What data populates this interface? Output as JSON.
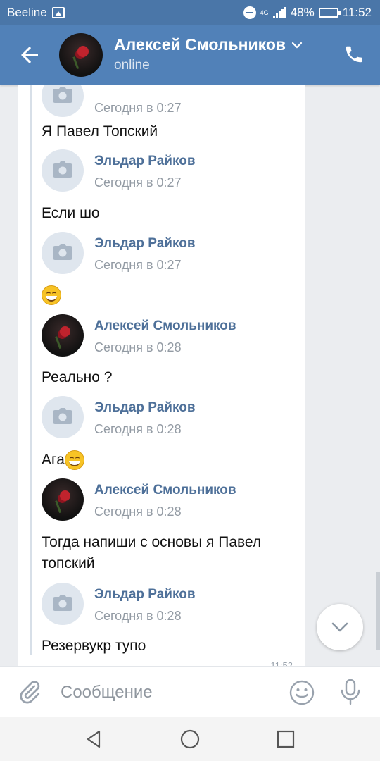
{
  "status_bar": {
    "carrier": "Beeline",
    "network": "4G",
    "battery_percent": "48%",
    "battery_level": 0.48,
    "time": "11:52"
  },
  "header": {
    "contact_name": "Алексей Смольников",
    "status": "online",
    "icons": [
      "back-arrow-icon",
      "chevron-down-icon",
      "phone-icon"
    ]
  },
  "messages": [
    {
      "author": "",
      "time": "Сегодня в 0:27",
      "avatar": "placeholder",
      "text": "Я Павел Топский",
      "emoji_after": false
    },
    {
      "author": "Эльдар Райков",
      "time": "Сегодня в 0:27",
      "avatar": "placeholder",
      "text": "Если шо",
      "emoji_after": false
    },
    {
      "author": "Эльдар Райков",
      "time": "Сегодня в 0:27",
      "avatar": "placeholder",
      "text": "",
      "emoji_after": true
    },
    {
      "author": "Алексей Смольников",
      "time": "Сегодня в 0:28",
      "avatar": "photo",
      "text": "Реально ?",
      "emoji_after": false
    },
    {
      "author": "Эльдар Райков",
      "time": "Сегодня в 0:28",
      "avatar": "placeholder",
      "text": "Ага",
      "emoji_after": true
    },
    {
      "author": "Алексей Смольников",
      "time": "Сегодня в 0:28",
      "avatar": "photo",
      "text": "Тогда напиши с основы я Павел топский",
      "emoji_after": false
    },
    {
      "author": "Эльдар Райков",
      "time": "Сегодня в 0:28",
      "avatar": "placeholder",
      "text": "Резервукр тупо",
      "emoji_after": false
    }
  ],
  "message_time_partial": "11:52",
  "composer": {
    "placeholder": "Сообщение",
    "icons": [
      "paperclip-icon",
      "emoji-icon",
      "mic-icon"
    ]
  },
  "colors": {
    "toolbar": "#5181b8",
    "status_bar": "#4a76a8",
    "author_link": "#4e7099",
    "timestamp": "#939ba4"
  }
}
